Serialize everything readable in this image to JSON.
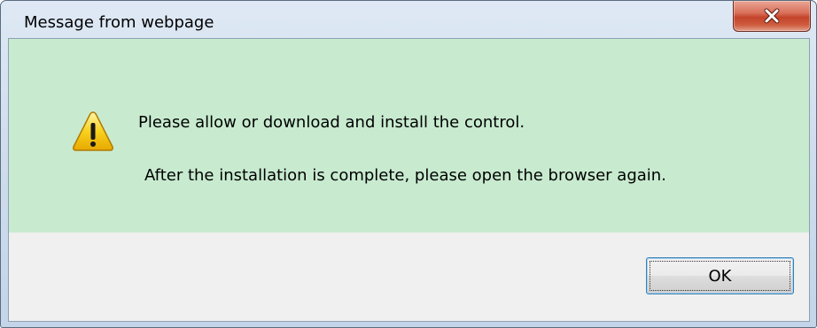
{
  "dialog": {
    "title": "Message from webpage",
    "close_icon": "close-icon",
    "warning_icon": "warning-icon",
    "message_line1": "Please allow or download and install the control.",
    "message_line2": "After the installation is complete, please open the browser again.",
    "ok_label": "OK"
  },
  "colors": {
    "message_background": "#c8ebd0",
    "close_button": "#c3442a",
    "warning_yellow": "#f5c400"
  }
}
